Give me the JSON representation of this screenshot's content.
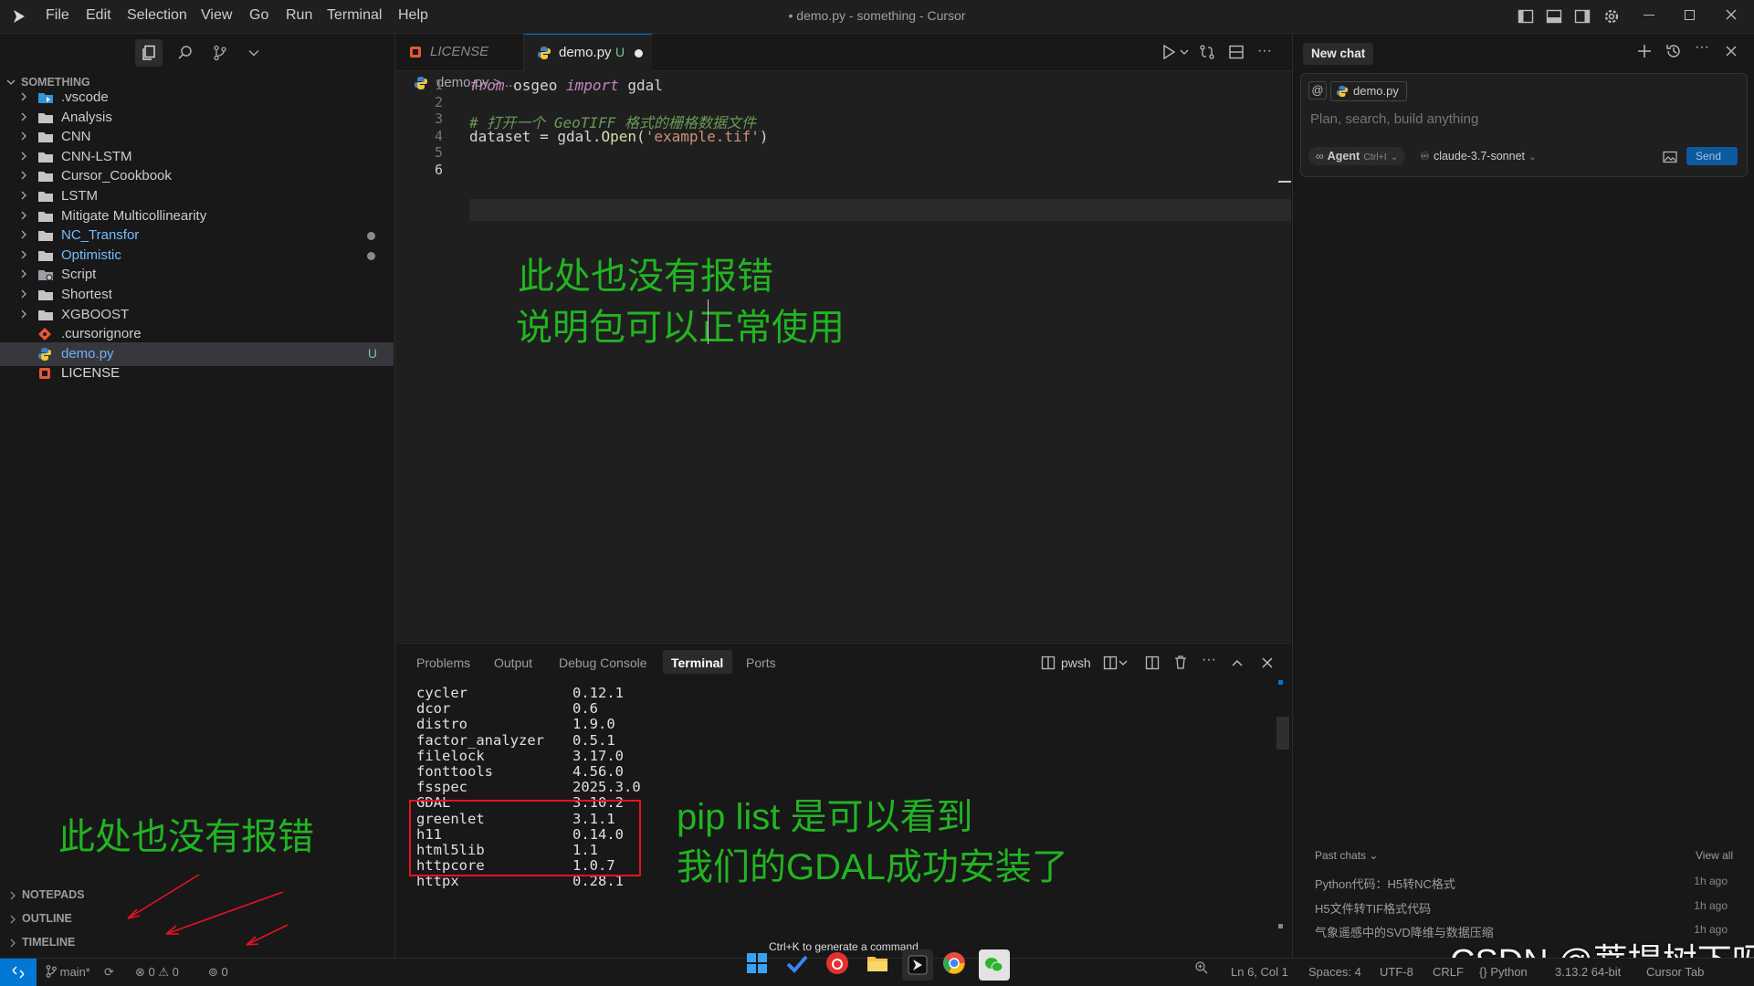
{
  "window": {
    "title": "• demo.py - something - Cursor"
  },
  "menu": [
    "File",
    "Edit",
    "Selection",
    "View",
    "Go",
    "Run",
    "Terminal",
    "Help"
  ],
  "sidebar": {
    "section_title": "SOMETHING",
    "items": [
      {
        "label": ".vscode",
        "kind": "folder-special"
      },
      {
        "label": "Analysis",
        "kind": "folder"
      },
      {
        "label": "CNN",
        "kind": "folder"
      },
      {
        "label": "CNN-LSTM",
        "kind": "folder"
      },
      {
        "label": "Cursor_Cookbook",
        "kind": "folder"
      },
      {
        "label": "LSTM",
        "kind": "folder"
      },
      {
        "label": "Mitigate Multicollinearity",
        "kind": "folder"
      },
      {
        "label": "NC_Transfor",
        "kind": "folder",
        "modified": true
      },
      {
        "label": "Optimistic",
        "kind": "folder",
        "modified": true
      },
      {
        "label": "Script",
        "kind": "folder-special"
      },
      {
        "label": "Shortest",
        "kind": "folder"
      },
      {
        "label": "XGBOOST",
        "kind": "folder"
      },
      {
        "label": ".cursorignore",
        "kind": "git-file"
      },
      {
        "label": "demo.py",
        "kind": "python-file",
        "badge": "U",
        "selected": true
      },
      {
        "label": "LICENSE",
        "kind": "license-file"
      }
    ],
    "bottom_sections": [
      "NOTEPADS",
      "OUTLINE",
      "TIMELINE"
    ]
  },
  "editor": {
    "tabs": [
      {
        "label": "LICENSE",
        "active": false
      },
      {
        "label": "demo.py",
        "badge": "U",
        "active": true,
        "dirty": true
      }
    ],
    "breadcrumb": {
      "file": "demo.py",
      "rest": "> ..."
    },
    "lines": [
      {
        "n": "1",
        "tokens": [
          {
            "t": "from",
            "c": "kw"
          },
          {
            "t": " osgeo ",
            "c": "pl"
          },
          {
            "t": "import",
            "c": "kw"
          },
          {
            "t": " gdal",
            "c": "pl"
          }
        ]
      },
      {
        "n": "2",
        "tokens": []
      },
      {
        "n": "3",
        "tokens": [
          {
            "t": "# 打开一个 GeoTIFF 格式的栅格数据文件",
            "c": "cm"
          }
        ]
      },
      {
        "n": "4",
        "tokens": [
          {
            "t": "dataset",
            "c": "pl"
          },
          {
            "t": " = ",
            "c": "pl"
          },
          {
            "t": "gdal",
            "c": "pl"
          },
          {
            "t": ".",
            "c": "pl"
          },
          {
            "t": "Open",
            "c": "fn"
          },
          {
            "t": "(",
            "c": "pl"
          },
          {
            "t": "'example.tif'",
            "c": "st"
          },
          {
            "t": ")",
            "c": "pl"
          }
        ]
      },
      {
        "n": "5",
        "tokens": []
      },
      {
        "n": "6",
        "tokens": []
      }
    ],
    "annotation": {
      "line1": "此处也没有报错",
      "line2": "说明包可以正常使用"
    }
  },
  "panel": {
    "tabs": [
      {
        "label": "Problems"
      },
      {
        "label": "Output"
      },
      {
        "label": "Debug Console"
      },
      {
        "label": "Terminal",
        "active": true
      },
      {
        "label": "Ports"
      }
    ],
    "shell_label": "pwsh",
    "packages": [
      {
        "name": "cycler",
        "version": "0.12.1"
      },
      {
        "name": "dcor",
        "version": "0.6"
      },
      {
        "name": "distro",
        "version": "1.9.0"
      },
      {
        "name": "factor_analyzer",
        "version": "0.5.1"
      },
      {
        "name": "filelock",
        "version": "3.17.0"
      },
      {
        "name": "fonttools",
        "version": "4.56.0"
      },
      {
        "name": "fsspec",
        "version": "2025.3.0"
      },
      {
        "name": "GDAL",
        "version": "3.10.2"
      },
      {
        "name": "greenlet",
        "version": "3.1.1"
      },
      {
        "name": "h11",
        "version": "0.14.0"
      },
      {
        "name": "html5lib",
        "version": "1.1"
      },
      {
        "name": "httpcore",
        "version": "1.0.7"
      },
      {
        "name": "httpx",
        "version": "0.28.1"
      }
    ],
    "annotation": {
      "line1": "pip list 是可以看到",
      "line2": "我们的GDAL成功安装了"
    },
    "hint": "Ctrl+K to generate a command"
  },
  "left_annotation": "此处也没有报错",
  "chat": {
    "title": "New chat",
    "context_chip": "demo.py",
    "placeholder": "Plan, search, build anything",
    "mode": "Agent",
    "mode_shortcut": "Ctrl+I",
    "model": "claude-3.7-sonnet",
    "send": "Send",
    "past_chats_label": "Past chats",
    "view_all": "View all",
    "history": [
      {
        "title": "Python代码：H5转NC格式",
        "time": "1h ago"
      },
      {
        "title": "H5文件转TIF格式代码",
        "time": "1h ago"
      },
      {
        "title": "气象遥感中的SVD降维与数据压缩",
        "time": "1h ago"
      }
    ]
  },
  "status": {
    "branch": "main*",
    "errors": "0",
    "warnings": "0",
    "ports": "0",
    "position": "Ln 6, Col 1",
    "spaces": "Spaces: 4",
    "encoding": "UTF-8",
    "eol": "CRLF",
    "language": "Python",
    "interpreter": "3.13.2 64-bit",
    "cursor_tab": "Cursor Tab"
  },
  "watermark": "CSDN @菩提树下呀",
  "colors": {
    "accent": "#0078d4",
    "annotation": "#22b422",
    "highlight_box": "#e81123"
  }
}
